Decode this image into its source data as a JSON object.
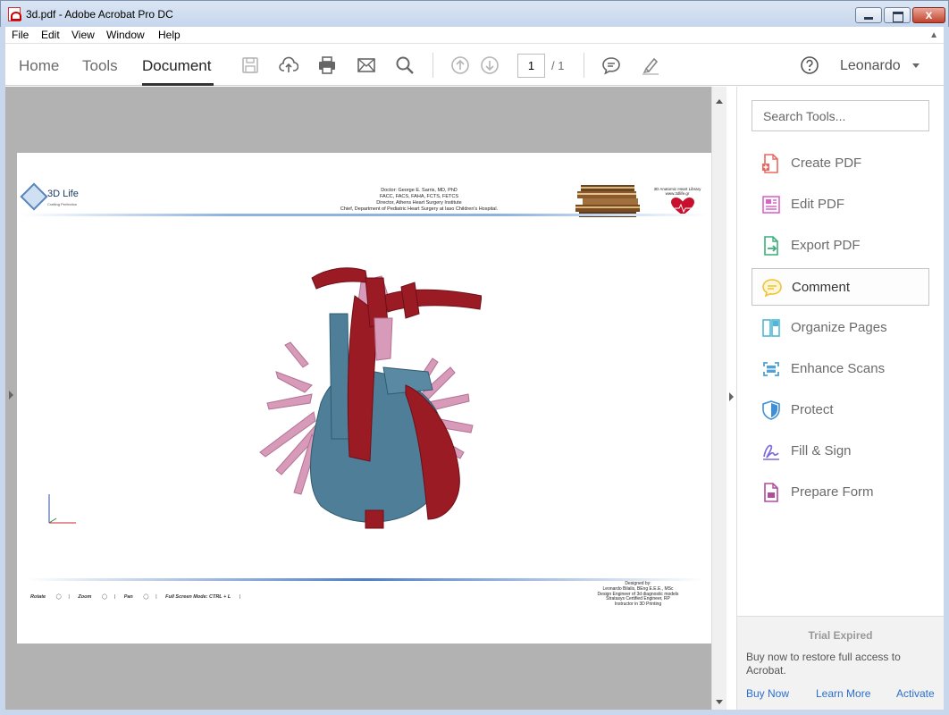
{
  "window": {
    "title": "3d.pdf - Adobe Acrobat Pro DC",
    "close_glyph": "x"
  },
  "menu": {
    "file": "File",
    "edit": "Edit",
    "view": "View",
    "window": "Window",
    "help": "Help"
  },
  "toolbar": {
    "tabs": {
      "home": "Home",
      "tools": "Tools",
      "document": "Document"
    },
    "active_tab": "Document",
    "page_current": "1",
    "page_total": "/ 1",
    "user": "Leonardo"
  },
  "pdf": {
    "logo_name": "3D Life",
    "logo_tagline": "Crafting Perfection",
    "header_lines": [
      "Doctor: George E. Sarris, MD, PhD",
      "FACC, FACS, FAHA, FCTS, FETCS",
      "Director, Athens Heart Surgery Institute",
      "Chief, Department of Pediatric Heart Surgery at Iaso Children's Hospital."
    ],
    "library_lines": [
      "3D Anatomic Heart Library",
      "www.3dlife.gr"
    ],
    "controls": {
      "rotate": "Rotate",
      "zoom": "Zoom",
      "pan": "Pan",
      "fullscreen": "Full Screen Mode:  CTRL + L"
    },
    "credit_lines": [
      "Designed by:",
      "Leonardo Bilalis, BEng E.E.E., MSc",
      "Design Engineer of 3d diagnostic models",
      "Stratasys Certified Engineer, RP",
      "Instructor in 3D Printing"
    ]
  },
  "right_pane": {
    "search_placeholder": "Search Tools...",
    "tools": [
      {
        "label": "Create PDF",
        "icon": "create-pdf-icon",
        "color": "#e8695f"
      },
      {
        "label": "Edit PDF",
        "icon": "edit-pdf-icon",
        "color": "#d965c8"
      },
      {
        "label": "Export PDF",
        "icon": "export-pdf-icon",
        "color": "#3fae7a"
      },
      {
        "label": "Comment",
        "icon": "comment-icon",
        "color": "#f0c233"
      },
      {
        "label": "Organize Pages",
        "icon": "organize-pages-icon",
        "color": "#4fb7d6"
      },
      {
        "label": "Enhance Scans",
        "icon": "enhance-scans-icon",
        "color": "#4fa1d6"
      },
      {
        "label": "Protect",
        "icon": "protect-icon",
        "color": "#3f8fd6"
      },
      {
        "label": "Fill & Sign",
        "icon": "fill-sign-icon",
        "color": "#7e6bd6"
      },
      {
        "label": "Prepare Form",
        "icon": "prepare-form-icon",
        "color": "#b04d9c"
      }
    ],
    "selected_tool": "Comment",
    "trial": {
      "title": "Trial Expired",
      "message": "Buy now to restore full access to Acrobat.",
      "buy": "Buy Now",
      "learn": "Learn More",
      "activate": "Activate"
    }
  }
}
